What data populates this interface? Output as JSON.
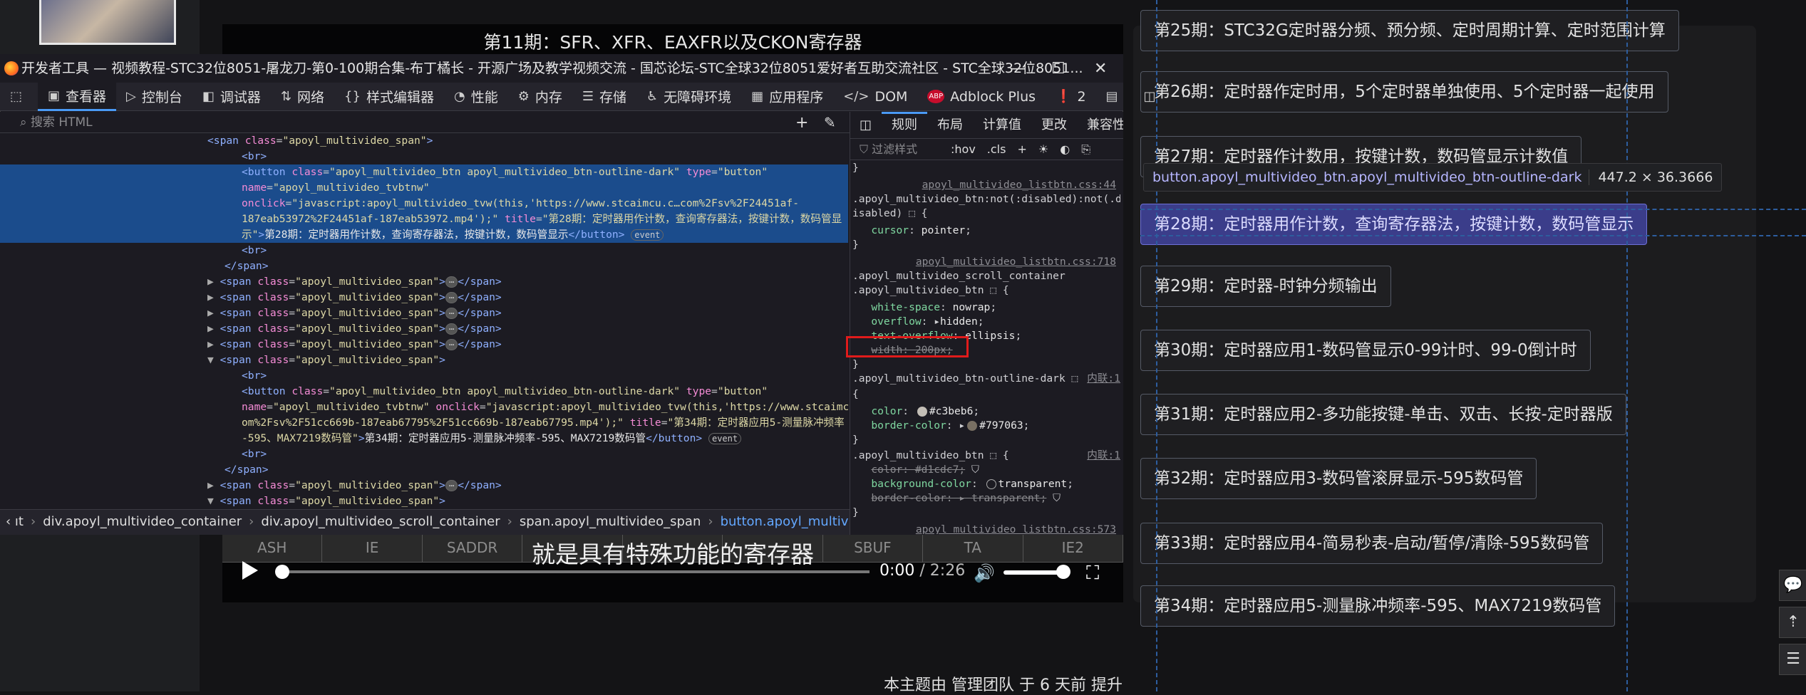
{
  "video": {
    "title": "第11期：SFR、XFR、EAXFR以及CKON寄存器",
    "subtitle": "就是具有特殊功能的寄存器",
    "table_cells": [
      "ASH",
      "IE",
      "SADDR",
      "",
      "",
      "",
      "SBUF",
      "TA",
      "IE2"
    ],
    "time_current": "0:00",
    "time_total": " / 2:26"
  },
  "footer_note": "本主题由 管理团队 于 6 天前 提升",
  "episodes": [
    "第25期：STC32G定时器分频、预分频、定时周期计算、定时范围计算",
    "第26期：定时器作定时用，5个定时器单独使用、5个定时器一起使用",
    "第27期：定时器作计数用，按键计数，数码管显示计数值",
    "第28期：定时器用作计数，查询寄存器法，按键计数，数码管显示",
    "第29期：定时器-时钟分频输出",
    "第30期：定时器应用1-数码管显示0-99计时、99-0倒计时",
    "第31期：定时器应用2-多功能按键-单击、双击、长按-定时器版",
    "第32期：定时器应用3-数码管滚屏显示-595数码管",
    "第33期：定时器应用4-简易秒表-启动/暂停/清除-595数码管",
    "第34期：定时器应用5-测量脉冲频率-595、MAX7219数码管"
  ],
  "tooltip": {
    "selector": "button.apoyl_multivideo_btn.apoyl_multivideo_btn-outline-dark",
    "size": "447.2 × 36.3666"
  },
  "devtools": {
    "window_title": "开发者工具 — 视频教程-STC32位8051-屠龙刀-第0-100期合集-布丁橘长 - 开源广场及教学视频交流 - 国芯论坛-STC全球32位8051爱好者互助交流社区 - STC全球32位8051...",
    "tabs": [
      {
        "icon": "▣",
        "label": "查看器"
      },
      {
        "icon": "▷",
        "label": "控制台"
      },
      {
        "icon": "◧",
        "label": "调试器"
      },
      {
        "icon": "⇅",
        "label": "网络"
      },
      {
        "icon": "{}",
        "label": "样式编辑器"
      },
      {
        "icon": "◔",
        "label": "性能"
      },
      {
        "icon": "⚙",
        "label": "内存"
      },
      {
        "icon": "☰",
        "label": "存储"
      },
      {
        "icon": "♿",
        "label": "无障碍环境"
      },
      {
        "icon": "▦",
        "label": "应用程序"
      },
      {
        "icon": "</>",
        "label": "DOM"
      },
      {
        "icon": "ABP",
        "label": "Adblock Plus"
      }
    ],
    "error_count": "2",
    "search_placeholder": "搜索 HTML",
    "html_lines": [
      {
        "indent": 12,
        "html": "<span class='tag'>&lt;span</span> <span class='attr'>class</span>=<span class='val'>\"apoyl_multivideo_span\"</span><span class='tag'>&gt;</span>"
      },
      {
        "indent": 14,
        "html": "<span class='tag'>&lt;br&gt;</span>"
      },
      {
        "indent": 14,
        "sel": true,
        "html": "<span class='tag'>&lt;button</span> <span class='attr'>class</span>=<span class='val'>\"apoyl_multivideo_btn apoyl_multivideo_btn-outline-dark\"</span> <span class='attr'>type</span>=<span class='val'>\"button\"</span>"
      },
      {
        "indent": 14,
        "sel": true,
        "html": "<span class='attr'>name</span>=<span class='val'>\"apoyl_multivideo_tvbtnw\"</span>"
      },
      {
        "indent": 14,
        "sel": true,
        "html": "<span class='attr'>onclick</span>=<span class='val'>\"javascript:apoyl_multivideo_tvw(this,'https://www.stcaimcu.c…com%2Fsv%2F24451af-</span>"
      },
      {
        "indent": 14,
        "sel": true,
        "html": "<span class='val'>187eab53972%2F24451af-187eab53972.mp4');\"</span> <span class='attr'>title</span>=<span class='val'>\"第28期：定时器用作计数，查询寄存器法，按键计数，数码管显</span>"
      },
      {
        "indent": 14,
        "sel": true,
        "html": "<span class='val'>示\"</span><span class='tag'>&gt;</span><span class='txt'>第28期：定时器用作计数，查询寄存器法，按键计数，数码管显示</span><span class='tag'>&lt;/button&gt;</span> <span class='badge'>event</span>"
      },
      {
        "indent": 14,
        "html": "<span class='tag'>&lt;br&gt;</span>"
      },
      {
        "indent": 13,
        "html": "<span class='tag'>&lt;/span&gt;</span>"
      },
      {
        "indent": 12,
        "html": "<span class='tri'>▶</span> <span class='tag'>&lt;span</span> <span class='attr'>class</span>=<span class='val'>\"apoyl_multivideo_span\"</span><span class='tag'>&gt;</span><span class='badge ell'>⋯</span><span class='tag'>&lt;/span&gt;</span>"
      },
      {
        "indent": 12,
        "html": "<span class='tri'>▶</span> <span class='tag'>&lt;span</span> <span class='attr'>class</span>=<span class='val'>\"apoyl_multivideo_span\"</span><span class='tag'>&gt;</span><span class='badge ell'>⋯</span><span class='tag'>&lt;/span&gt;</span>"
      },
      {
        "indent": 12,
        "html": "<span class='tri'>▶</span> <span class='tag'>&lt;span</span> <span class='attr'>class</span>=<span class='val'>\"apoyl_multivideo_span\"</span><span class='tag'>&gt;</span><span class='badge ell'>⋯</span><span class='tag'>&lt;/span&gt;</span>"
      },
      {
        "indent": 12,
        "html": "<span class='tri'>▶</span> <span class='tag'>&lt;span</span> <span class='attr'>class</span>=<span class='val'>\"apoyl_multivideo_span\"</span><span class='tag'>&gt;</span><span class='badge ell'>⋯</span><span class='tag'>&lt;/span&gt;</span>"
      },
      {
        "indent": 12,
        "html": "<span class='tri'>▶</span> <span class='tag'>&lt;span</span> <span class='attr'>class</span>=<span class='val'>\"apoyl_multivideo_span\"</span><span class='tag'>&gt;</span><span class='badge ell'>⋯</span><span class='tag'>&lt;/span&gt;</span>"
      },
      {
        "indent": 12,
        "html": "<span class='tri'>▼</span> <span class='tag'>&lt;span</span> <span class='attr'>class</span>=<span class='val'>\"apoyl_multivideo_span\"</span><span class='tag'>&gt;</span>"
      },
      {
        "indent": 14,
        "html": "<span class='tag'>&lt;br&gt;</span>"
      },
      {
        "indent": 14,
        "html": "<span class='tag'>&lt;button</span> <span class='attr'>class</span>=<span class='val'>\"apoyl_multivideo_btn apoyl_multivideo_btn-outline-dark\"</span> <span class='attr'>type</span>=<span class='val'>\"button\"</span>"
      },
      {
        "indent": 14,
        "html": "<span class='attr'>name</span>=<span class='val'>\"apoyl_multivideo_tvbtnw\"</span> <span class='attr'>onclick</span>=<span class='val'>\"javascript:apoyl_multivideo_tvw(this,'https://www.stcaimcu.c…</span>"
      },
      {
        "indent": 14,
        "html": "<span class='val'>om%2Fsv%2F51cc669b-187eab67795%2F51cc669b-187eab67795.mp4');\"</span> <span class='attr'>title</span>=<span class='val'>\"第34期：定时器应用5-测量脉冲频率</span>"
      },
      {
        "indent": 14,
        "html": "<span class='val'>-595、MAX7219数码管\"</span><span class='tag'>&gt;</span><span class='txt'>第34期：定时器应用5-测量脉冲频率-595、MAX7219数码管</span><span class='tag'>&lt;/button&gt;</span> <span class='badge'>event</span>"
      },
      {
        "indent": 14,
        "html": "<span class='tag'>&lt;br&gt;</span>"
      },
      {
        "indent": 13,
        "html": "<span class='tag'>&lt;/span&gt;</span>"
      },
      {
        "indent": 12,
        "html": "<span class='tri'>▶</span> <span class='tag'>&lt;span</span> <span class='attr'>class</span>=<span class='val'>\"apoyl_multivideo_span\"</span><span class='tag'>&gt;</span><span class='badge ell'>⋯</span><span class='tag'>&lt;/span&gt;</span>"
      },
      {
        "indent": 12,
        "html": "<span class='tri'>▼</span> <span class='tag'>&lt;span</span> <span class='attr'>class</span>=<span class='val'>\"apoyl_multivideo_span\"</span><span class='tag'>&gt;</span>"
      },
      {
        "indent": 14,
        "html": "<span class='tag'>&lt;br&gt;</span>"
      }
    ],
    "breadcrumbs": [
      "ıt",
      "div.apoyl_multivideo_container",
      "div.apoyl_multivideo_scroll_container",
      "span.apoyl_multivideo_span",
      "button.apoyl_multivideo_btn.apoyl_multiv..."
    ],
    "rule_tabs": [
      "规则",
      "布局",
      "计算值",
      "更改",
      "兼容性"
    ],
    "rules_filter_placeholder": "过滤样式",
    "rules_filter_buttons": [
      ":hov",
      ".cls",
      "+",
      "☀",
      "◐",
      "⎘"
    ],
    "rule_lines": [
      {
        "html": "}"
      },
      {
        "src": true,
        "html": "apoyl_multivideo_listbtn.css:44"
      },
      {
        "html": ".apoyl_multivideo_btn:not(:disabled):not(.d"
      },
      {
        "html": "isabled) ⬚ {"
      },
      {
        "html": "&nbsp;&nbsp;&nbsp;<span class='prop'>cursor</span>: <span class='pval'>pointer</span>;"
      },
      {
        "html": "}"
      },
      {
        "src": true,
        "html": "apoyl_multivideo_listbtn.css:718"
      },
      {
        "html": ".apoyl_multivideo_scroll_container"
      },
      {
        "html": ".apoyl_multivideo_btn ⬚ {"
      },
      {
        "html": "&nbsp;&nbsp;&nbsp;<span class='prop'>white-space</span>: <span class='pval'>nowrap</span>;"
      },
      {
        "html": "&nbsp;&nbsp;&nbsp;<span class='prop'>overflow</span>: ▸<span class='pval'>hidden</span>;"
      },
      {
        "html": "&nbsp;&nbsp;&nbsp;<span class='prop'>text-overflow</span>: <span class='pval'>ellipsis</span>;"
      },
      {
        "html": "&nbsp;&nbsp;&nbsp;<span class='strike'>width: 200px;</span>"
      },
      {
        "html": "}"
      },
      {
        "html": ".apoyl_multivideo_btn-outline-dark ⬚ <span style='float:right;color:#8d8d93;text-decoration:underline'>内联:1</span>"
      },
      {
        "html": "{"
      },
      {
        "html": "&nbsp;&nbsp;&nbsp;<span class='prop'>color</span>: <span class='sw' style='background:#c3beb6'></span><span class='pval'>#c3beb6</span>;"
      },
      {
        "html": "&nbsp;&nbsp;&nbsp;<span class='prop'>border-color</span>: ▸<span class='sw' style='background:#797063'></span><span class='pval'>#797063</span>;"
      },
      {
        "html": "}"
      },
      {
        "html": ".apoyl_multivideo_btn ⬚ { <span style='float:right;color:#8d8d93;text-decoration:underline'>内联:1</span>"
      },
      {
        "html": "&nbsp;&nbsp;&nbsp;<span class='strike'>color: #d1cdc7;</span> ⛉"
      },
      {
        "html": "&nbsp;&nbsp;&nbsp;<span class='prop'>background-color</span>: <span class='sw' style='border:1px solid #aaa'></span><span class='pval'>transparent</span>;"
      },
      {
        "html": "&nbsp;&nbsp;&nbsp;<span class='strike'>border-color: ▸ transparent;</span> ⛉"
      },
      {
        "html": "}"
      },
      {
        "src": true,
        "html": "apoyl_multivideo_listbtn.css:573"
      }
    ]
  }
}
